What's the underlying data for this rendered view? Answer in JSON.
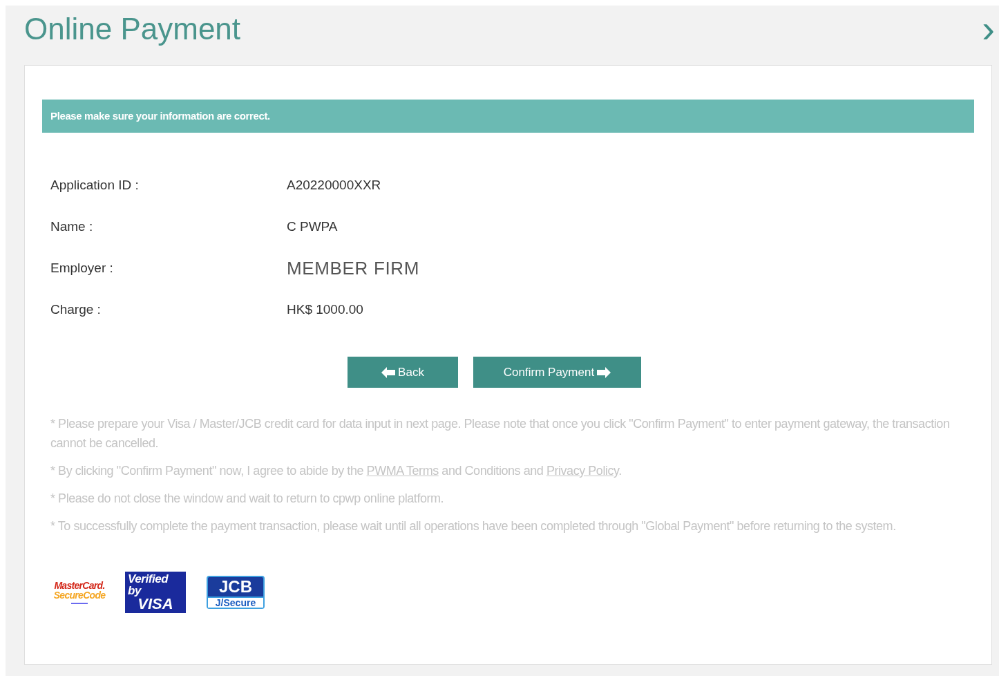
{
  "page": {
    "title": "Online Payment",
    "next": "›"
  },
  "banner": "Please make sure your information are correct.",
  "fields": [
    {
      "label": "Application ID :",
      "value": "A20220000XXR",
      "kind": "plain"
    },
    {
      "label": "Name :",
      "value": "C PWPA",
      "kind": "plain"
    },
    {
      "label": "Employer :",
      "value": "MEMBER FIRM",
      "kind": "large"
    },
    {
      "label": "Charge :",
      "value": "HK$ 1000.00",
      "kind": "plain"
    }
  ],
  "buttons": [
    {
      "label": "Back",
      "kind": "back"
    },
    {
      "label": "Confirm Payment",
      "kind": "confirm"
    }
  ],
  "notes": [
    [
      {
        "kind": "text",
        "text": "* Please prepare your Visa / Master/JCB credit card for data input in next page. Please note that once you click \"Confirm Payment\" to enter payment gateway, the transaction cannot be cancelled."
      }
    ],
    [
      {
        "kind": "text",
        "text": "* By clicking \"Confirm Payment\" now, I agree to abide by the "
      },
      {
        "kind": "link",
        "text": "PWMA Terms"
      },
      {
        "kind": "text",
        "text": " and Conditions and "
      },
      {
        "kind": "link",
        "text": "Privacy Policy"
      },
      {
        "kind": "text",
        "text": "."
      }
    ],
    [
      {
        "kind": "text",
        "text": "* Please do not close the window and wait to return to cpwp online platform."
      }
    ],
    [
      {
        "kind": "text",
        "text": "* To successfully complete the payment transaction, please wait until all operations have been completed through \"Global Payment\" before returning to the system."
      }
    ]
  ],
  "logos": [
    {
      "kind": "mastercard",
      "lines": [
        "MasterCard.",
        "SecureCode"
      ]
    },
    {
      "kind": "visa",
      "lines": [
        "Verified by",
        "VISA"
      ]
    },
    {
      "kind": "jcb",
      "lines": [
        "JCB",
        "J/Secure"
      ]
    }
  ]
}
